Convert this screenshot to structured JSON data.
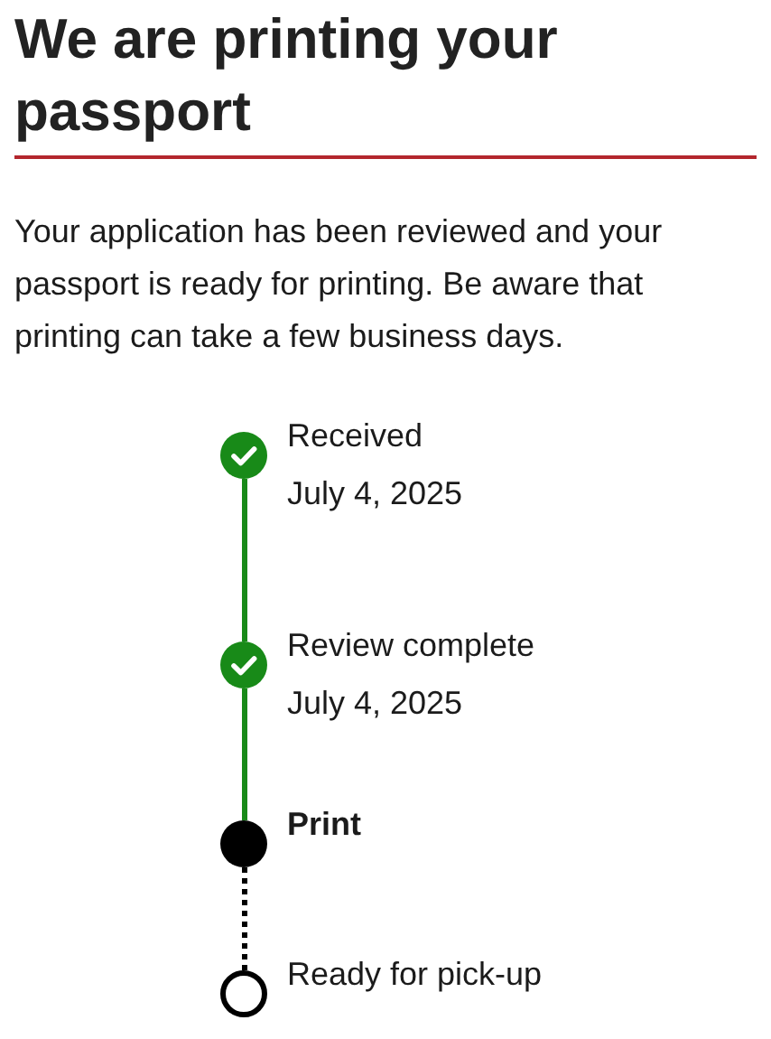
{
  "title": "We are printing your passport",
  "description": "Your application has been reviewed and your passport is ready for printing. Be aware that printing can take a few business days.",
  "steps": [
    {
      "label": "Received",
      "date": "July 4, 2025",
      "kind": "complete"
    },
    {
      "label": "Review complete",
      "date": "July 4, 2025",
      "kind": "complete"
    },
    {
      "label": "Print",
      "kind": "current"
    },
    {
      "label": "Ready for pick-up",
      "kind": "upcoming"
    }
  ]
}
